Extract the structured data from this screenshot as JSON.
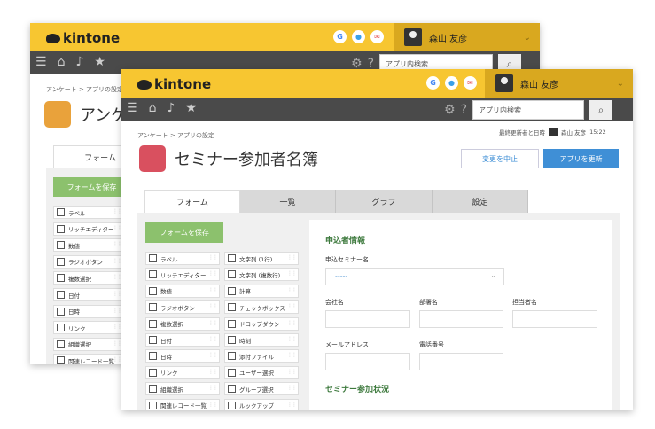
{
  "back_window": {
    "logo": "kintone",
    "user_name": "森山 友彦",
    "search_placeholder": "アプリ内検索",
    "breadcrumb": "アンケート > アプリの設定",
    "app_title": "アンケ",
    "tab_form": "フォーム",
    "save_button": "フォームを保存",
    "palette": [
      "ラベル",
      "リッチエディター",
      "数値",
      "ラジオボタン",
      "複数選択",
      "日付",
      "日時",
      "リンク",
      "組織選択",
      "関連レコード一覧"
    ]
  },
  "front_window": {
    "logo": "kintone",
    "user_name": "森山 友彦",
    "search_placeholder": "アプリ内検索",
    "breadcrumb": "アンケート > アプリの設定",
    "last_updated_label": "最終更新者と日時",
    "last_updated_user": "森山 友彦",
    "last_updated_time": "15:22",
    "app_title": "セミナー参加者名簿",
    "cancel_button": "変更を中止",
    "update_button": "アプリを更新",
    "tabs": [
      "フォーム",
      "一覧",
      "グラフ",
      "設定"
    ],
    "save_button": "フォームを保存",
    "palette_left": [
      "ラベル",
      "リッチエディター",
      "数値",
      "ラジオボタン",
      "複数選択",
      "日付",
      "日時",
      "リンク",
      "組織選択",
      "関連レコード一覧"
    ],
    "palette_right": [
      "文字列 (1行)",
      "文字列 (複数行)",
      "計算",
      "チェックボックス",
      "ドロップダウン",
      "時刻",
      "添付ファイル",
      "ユーザー選択",
      "グループ選択",
      "ルックアップ"
    ],
    "section1_title": "申込者情報",
    "seminar_label": "申込セミナー名",
    "seminar_value": "-----",
    "company_label": "会社名",
    "dept_label": "部署名",
    "person_label": "担当者名",
    "email_label": "メールアドレス",
    "phone_label": "電話番号",
    "section2_title": "セミナー参加状況"
  },
  "colors": {
    "brand_yellow": "#f7c631",
    "nav_dark": "#4a4a4a",
    "save_green": "#8cc16d",
    "primary_blue": "#3f8fd6"
  }
}
